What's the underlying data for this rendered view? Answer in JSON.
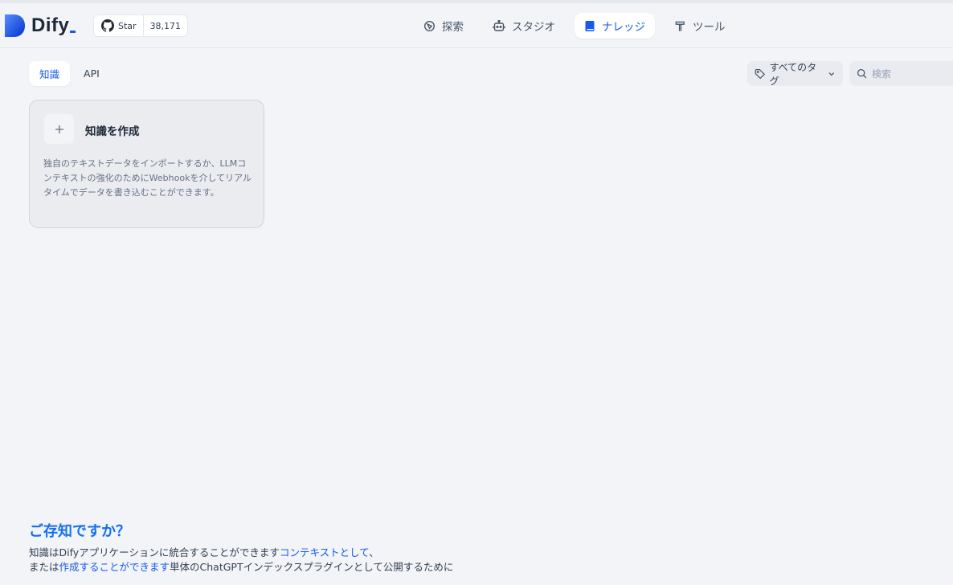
{
  "app": {
    "name": "Dify",
    "accent": "#155aef"
  },
  "github": {
    "star_label": "Star",
    "count": "38,171"
  },
  "nav": {
    "items": [
      {
        "label": "探索",
        "icon": "explore-icon"
      },
      {
        "label": "スタジオ",
        "icon": "robot-icon"
      },
      {
        "label": "ナレッジ",
        "icon": "book-icon",
        "active": true
      },
      {
        "label": "ツール",
        "icon": "hammer-icon"
      }
    ]
  },
  "tabs": [
    {
      "label": "知識",
      "active": true
    },
    {
      "label": "API",
      "active": false
    }
  ],
  "filter": {
    "tag_label": "すべてのタグ"
  },
  "search": {
    "placeholder": "検索",
    "value": ""
  },
  "create_card": {
    "title": "知識を作成",
    "description": "独自のテキストデータをインポートするか、LLMコンテキストの強化のためにWebhookを介してリアルタイムでデータを書き込むことができます。"
  },
  "tip": {
    "title": "ご存知ですか？",
    "line1_text": "知識はDifyアプリケーションに統合することができます",
    "line1_link": "コンテキストとして",
    "line1_end": "、",
    "line2_start": "または",
    "line2_link": "作成することができます",
    "line2_text": "単体のChatGPTインデックスプラグインとして公開するために"
  }
}
